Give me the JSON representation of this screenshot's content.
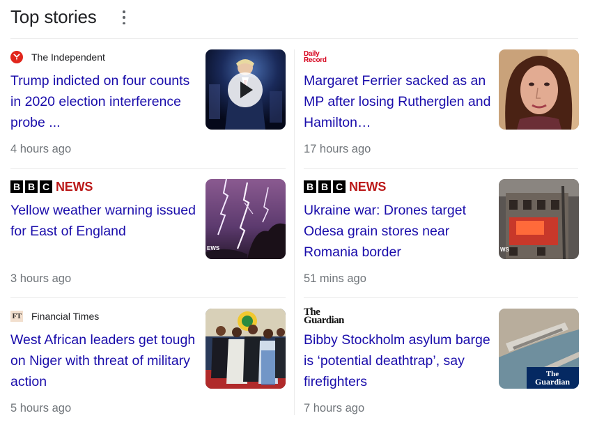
{
  "header": {
    "title": "Top stories",
    "menu_icon": "more-vert-icon"
  },
  "stories": [
    {
      "source": "The Independent",
      "logo": "independent-logo",
      "headline": "Trump indicted on four counts in 2020 election interference probe ...",
      "time": "4 hours ago",
      "thumbnail": "video-thumbnail",
      "has_play_button": true
    },
    {
      "source": "Daily Record",
      "logo_text": "Daily Record",
      "logo": "daily-record-logo",
      "headline": "Margaret Ferrier sacked as an MP after losing Rutherglen and Hamilton…",
      "time": "17 hours ago",
      "thumbnail": "portrait-photo"
    },
    {
      "source": "BBC NEWS",
      "logo_letters": [
        "B",
        "B",
        "C"
      ],
      "logo_word": "NEWS",
      "logo": "bbc-news-logo",
      "headline": "Yellow weather warning issued for East of England",
      "time": "3 hours ago",
      "thumbnail": "lightning-photo",
      "thumb_caption": "EWS"
    },
    {
      "source": "BBC NEWS",
      "logo_letters": [
        "B",
        "B",
        "C"
      ],
      "logo_word": "NEWS",
      "logo": "bbc-news-logo",
      "headline": "Ukraine war: Drones target Odesa grain stores near Romania border",
      "time": "51 mins ago",
      "thumbnail": "burning-building-photo",
      "thumb_caption": "WS"
    },
    {
      "source": "Financial Times",
      "logo_text": "FT",
      "logo": "ft-logo",
      "headline": "West African leaders get tough on Niger with threat of military action",
      "time": "5 hours ago",
      "thumbnail": "leaders-group-photo"
    },
    {
      "source": "The Guardian",
      "logo_line1": "The",
      "logo_line2": "Guardian",
      "logo": "guardian-logo",
      "headline": "Bibby Stockholm asylum barge is ‘potential deathtrap’, say firefighters",
      "time": "7 hours ago",
      "thumbnail": "barge-aerial-photo",
      "thumb_caption_line1": "The",
      "thumb_caption_line2": "Guardian"
    }
  ],
  "colors": {
    "headline": "#1a0dab",
    "meta": "#70757a",
    "divider": "#ebebeb",
    "bbc_red": "#bb1919",
    "independent_red": "#e1261c",
    "daily_record_red": "#d6001c"
  }
}
